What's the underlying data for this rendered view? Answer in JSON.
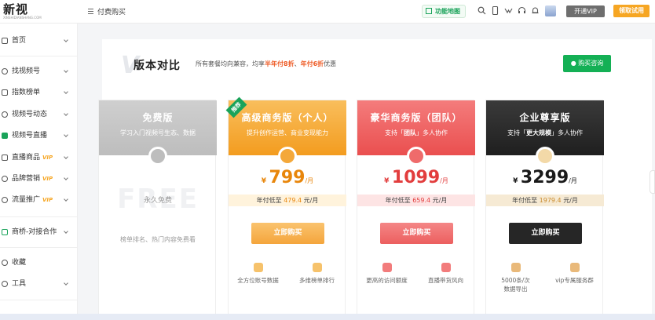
{
  "logo": {
    "main": "新视",
    "sub": "XINSHIDIANSHANG.COM"
  },
  "header": {
    "breadcrumb": "付费购买",
    "map_button": "功能地图",
    "vip_button": "开通VIP",
    "trial_button": "领取试用",
    "icons": [
      "search-icon",
      "mobile-icon",
      "mini-program-icon",
      "headset-icon",
      "bell-icon",
      "avatar"
    ]
  },
  "sidebar": {
    "items": [
      {
        "label": "首页",
        "icon": "home-icon",
        "vip": ""
      },
      {
        "label": "找视频号",
        "icon": "search-icon",
        "vip": ""
      },
      {
        "label": "指数榜单",
        "icon": "chart-icon",
        "vip": ""
      },
      {
        "label": "视频号动态",
        "icon": "video-icon",
        "vip": ""
      },
      {
        "label": "视频号直播",
        "icon": "live-icon",
        "vip": ""
      },
      {
        "label": "直播商品",
        "icon": "goods-icon",
        "vip": "VIP"
      },
      {
        "label": "品牌营销",
        "icon": "brand-icon",
        "vip": "VIP"
      },
      {
        "label": "流量推广",
        "icon": "traffic-icon",
        "vip": "VIP"
      },
      {
        "label": "商桥-对接合作",
        "icon": "bridge-icon",
        "vip": ""
      },
      {
        "label": "收藏",
        "icon": "star-icon",
        "vip": ""
      },
      {
        "label": "工具",
        "icon": "tool-icon",
        "vip": ""
      }
    ]
  },
  "panel": {
    "watermark": "V",
    "title": "版本对比",
    "subtitle_prefix": "所有套餐均向兼容，均享",
    "subtitle_half": "半年付8折",
    "subtitle_sep": "、",
    "subtitle_year": "年付6折",
    "subtitle_suffix": "优惠",
    "consult_button": "购买咨询"
  },
  "plans": [
    {
      "name": "免费版",
      "desc": "学习入门视频号生态、数据",
      "watermark": "FREE",
      "price_label": "永久免费",
      "note": "榜单排名、热门内容免费看",
      "head_color": "#c9c9c9",
      "features": []
    },
    {
      "name": "高级商务版（个人）",
      "desc": "提升创作运营、商业变现能力",
      "tag": "推荐",
      "currency": "¥",
      "price": "799",
      "unit": "/月",
      "strip_prefix": "年付低至",
      "strip_value": "479.4",
      "strip_suffix": "元/月",
      "buy": "立即购买",
      "head_color": "#f6a623",
      "price_color": "#e8860b",
      "strip_bg": "#fff3dc",
      "btn_color": "#f7b955",
      "features": [
        {
          "label": "全方位账号数据",
          "icon": "account-data-icon",
          "color": "#f6c26b"
        },
        {
          "label": "多维榜单排行",
          "icon": "rank-icon",
          "color": "#f6c26b"
        }
      ]
    },
    {
      "name": "豪华商务版（团队）",
      "desc_prefix": "支持「",
      "desc_bold": "团队",
      "desc_suffix": "」多人协作",
      "currency": "¥",
      "price": "1099",
      "unit": "/月",
      "strip_prefix": "年付低至",
      "strip_value": "659.4",
      "strip_suffix": "元/月",
      "buy": "立即购买",
      "head_color": "#ef5a5a",
      "price_color": "#e23d3d",
      "strip_bg": "#fde4e4",
      "btn_color": "#ee6b6b",
      "features": [
        {
          "label": "更高的访问额度",
          "icon": "quota-icon",
          "color": "#f27c7c"
        },
        {
          "label": "直播带货风向",
          "icon": "live-trend-icon",
          "color": "#f27c7c"
        }
      ]
    },
    {
      "name": "企业尊享版",
      "desc_prefix": "支持「",
      "desc_bold": "更大规模",
      "desc_suffix": "」多人协作",
      "currency": "¥",
      "price": "3299",
      "unit": "/月",
      "strip_prefix": "年付低至",
      "strip_value": "1979.4",
      "strip_suffix": "元/月",
      "buy": "立即购买",
      "head_color": "#2a2a2a",
      "price_color": "#1a1a1a",
      "strip_bg": "#f6ead4",
      "btn_color": "#2b2b2b",
      "features": [
        {
          "label": "5000条/次\n数据导出",
          "icon": "export-icon",
          "color": "#e9b97a"
        },
        {
          "label": "vip专属服务群",
          "icon": "vip-group-icon",
          "color": "#e9b97a"
        }
      ]
    }
  ]
}
